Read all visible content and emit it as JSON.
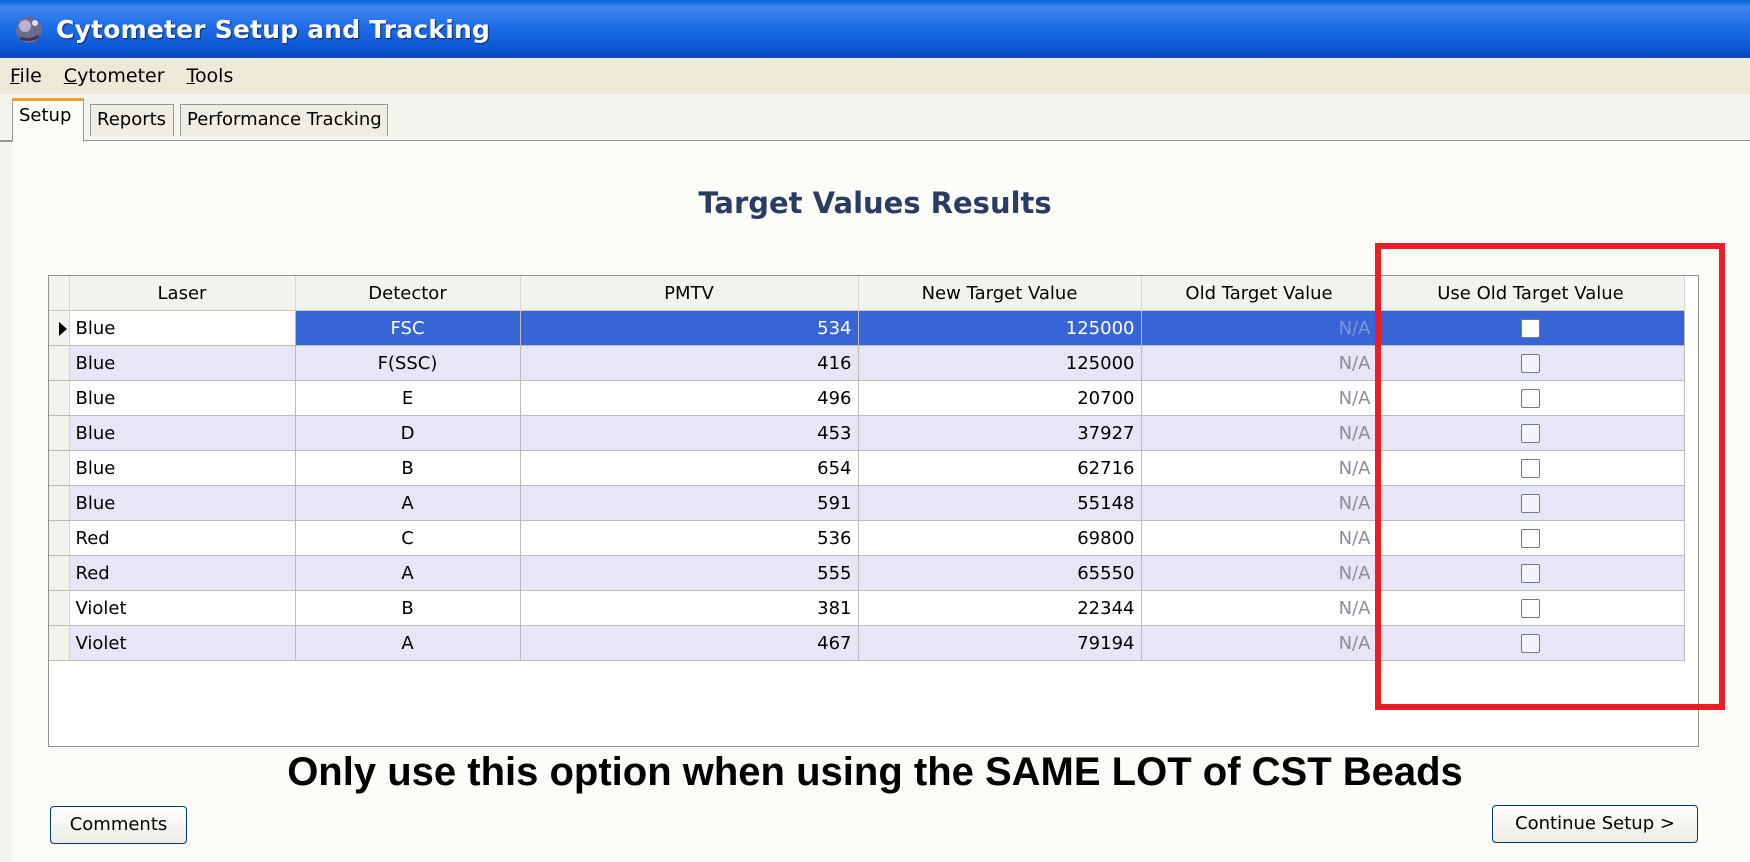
{
  "window": {
    "title": "Cytometer Setup and Tracking"
  },
  "menu": [
    {
      "label": "File",
      "mnemonic": "F",
      "rest": "ile"
    },
    {
      "label": "Cytometer",
      "mnemonic": "C",
      "rest": "ytometer"
    },
    {
      "label": "Tools",
      "mnemonic": "T",
      "rest": "ools"
    }
  ],
  "tabs": [
    {
      "label": "Setup",
      "active": true
    },
    {
      "label": "Reports",
      "active": false
    },
    {
      "label": "Performance Tracking",
      "active": false
    }
  ],
  "heading": "Target Values Results",
  "table": {
    "columns": [
      "Laser",
      "Detector",
      "PMTV",
      "New Target Value",
      "Old Target Value",
      "Use Old Target Value"
    ],
    "selected_row_index": 0,
    "rows": [
      {
        "laser": "Blue",
        "detector": "FSC",
        "pmtv": "534",
        "new_target": "125000",
        "old_target": "N/A",
        "use_old": false
      },
      {
        "laser": "Blue",
        "detector": "F(SSC)",
        "pmtv": "416",
        "new_target": "125000",
        "old_target": "N/A",
        "use_old": false
      },
      {
        "laser": "Blue",
        "detector": "E",
        "pmtv": "496",
        "new_target": "20700",
        "old_target": "N/A",
        "use_old": false
      },
      {
        "laser": "Blue",
        "detector": "D",
        "pmtv": "453",
        "new_target": "37927",
        "old_target": "N/A",
        "use_old": false
      },
      {
        "laser": "Blue",
        "detector": "B",
        "pmtv": "654",
        "new_target": "62716",
        "old_target": "N/A",
        "use_old": false
      },
      {
        "laser": "Blue",
        "detector": "A",
        "pmtv": "591",
        "new_target": "55148",
        "old_target": "N/A",
        "use_old": false
      },
      {
        "laser": "Red",
        "detector": "C",
        "pmtv": "536",
        "new_target": "69800",
        "old_target": "N/A",
        "use_old": false
      },
      {
        "laser": "Red",
        "detector": "A",
        "pmtv": "555",
        "new_target": "65550",
        "old_target": "N/A",
        "use_old": false
      },
      {
        "laser": "Violet",
        "detector": "B",
        "pmtv": "381",
        "new_target": "22344",
        "old_target": "N/A",
        "use_old": false
      },
      {
        "laser": "Violet",
        "detector": "A",
        "pmtv": "467",
        "new_target": "79194",
        "old_target": "N/A",
        "use_old": false
      }
    ]
  },
  "annotation": "Only use this option when using the SAME LOT of CST Beads",
  "buttons": {
    "comments": "Comments",
    "continue": "Continue Setup >"
  },
  "colors": {
    "highlight": "#ee1c24",
    "selection": "#3765d5",
    "titlebar": "#0a55d3"
  }
}
